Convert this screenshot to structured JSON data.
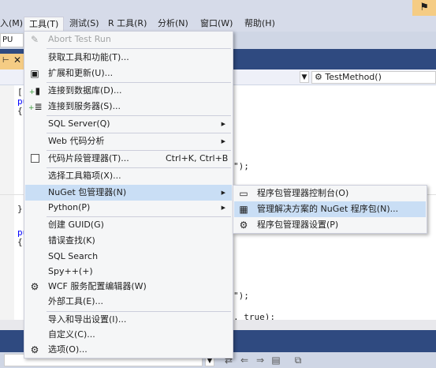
{
  "menubar": {
    "items": [
      "入(M)",
      "工具(T)",
      "测试(S)",
      "R 工具(R)",
      "分析(N)",
      "窗口(W)",
      "帮助(H)"
    ]
  },
  "toolbar": {
    "config_value": "PU"
  },
  "navbar": {
    "method": "TestMethod()"
  },
  "code": {
    "lines": [
      "[",
      "pu",
      "{",
      "\");",
      "}",
      "pu",
      "{",
      "\");",
      ", true);"
    ]
  },
  "tools_menu": {
    "items": [
      {
        "label": "Abort Test Run",
        "icon": "abort-icon"
      },
      {
        "label": "获取工具和功能(T)...",
        "icon": ""
      },
      {
        "label": "扩展和更新(U)...",
        "icon": "extensions-icon"
      },
      {
        "label": "连接到数据库(D)...",
        "icon": "database-connect-icon"
      },
      {
        "label": "连接到服务器(S)...",
        "icon": "server-connect-icon"
      },
      {
        "label": "SQL Server(Q)",
        "icon": ""
      },
      {
        "label": "Web 代码分析",
        "icon": ""
      },
      {
        "label": "代码片段管理器(T)...",
        "icon": "checkbox-icon",
        "shortcut": "Ctrl+K, Ctrl+B"
      },
      {
        "label": "选择工具箱项(X)...",
        "icon": ""
      },
      {
        "label": "NuGet 包管理器(N)",
        "icon": ""
      },
      {
        "label": "Python(P)",
        "icon": ""
      },
      {
        "label": "创建 GUID(G)",
        "icon": ""
      },
      {
        "label": "错误查找(K)",
        "icon": ""
      },
      {
        "label": "SQL Search",
        "icon": ""
      },
      {
        "label": "Spy++(+)",
        "icon": ""
      },
      {
        "label": "WCF 服务配置编辑器(W)",
        "icon": "wcf-gear-icon"
      },
      {
        "label": "外部工具(E)...",
        "icon": ""
      },
      {
        "label": "导入和导出设置(I)...",
        "icon": ""
      },
      {
        "label": "自定义(C)...",
        "icon": ""
      },
      {
        "label": "选项(O)...",
        "icon": "options-gear-icon"
      }
    ]
  },
  "nuget_submenu": {
    "items": [
      {
        "label": "程序包管理器控制台(O)",
        "icon": "console-icon"
      },
      {
        "label": "管理解决方案的 NuGet 程序包(N)...",
        "icon": "package-icon"
      },
      {
        "label": "程序包管理器设置(P)",
        "icon": "settings-gear-icon"
      }
    ]
  },
  "colors": {
    "menubar_bg": "#d6dbe9",
    "highlight": "#c9def5",
    "tab_active": "#f5cc84",
    "panel_dark": "#2f4a80"
  }
}
